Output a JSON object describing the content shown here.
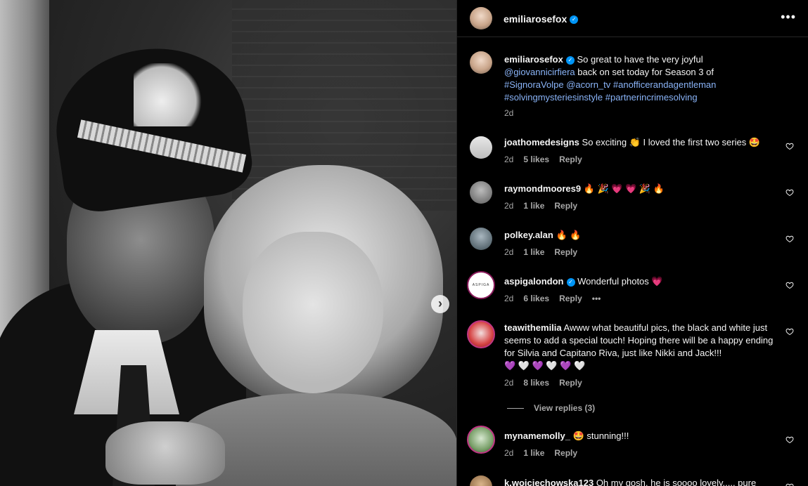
{
  "post": {
    "username": "emiliarosefox",
    "verified": true
  },
  "caption": {
    "username": "emiliarosefox",
    "text_1": "So great to have the very joyful",
    "mention_1": "@giovannicirfiera",
    "text_2": "back on set today for Season 3 of",
    "tag_1": "#SignoraVolpe",
    "mention_2": "@acorn_tv",
    "tag_2": "#anofficerandagentleman",
    "tag_3": "#solvingmysteriesinstyle",
    "tag_4": "#partnerincrimesolving",
    "time": "2d"
  },
  "comments": [
    {
      "username": "joathomedesigns",
      "text": "So exciting 👏 I loved the first two series 🤩",
      "time": "2d",
      "likes": "5 likes",
      "reply": "Reply"
    },
    {
      "username": "raymondmoores9",
      "text": "🔥 🎉 💗 💗 🎉 🔥",
      "time": "2d",
      "likes": "1 like",
      "reply": "Reply"
    },
    {
      "username": "polkey.alan",
      "text": "🔥 🔥",
      "time": "2d",
      "likes": "1 like",
      "reply": "Reply"
    },
    {
      "username": "aspigalondon",
      "text": "Wonderful photos 💗",
      "time": "2d",
      "likes": "6 likes",
      "reply": "Reply",
      "more": "•••"
    },
    {
      "username": "teawithemilia",
      "text": "Awww what beautiful pics, the black and white just seems to add a special touch! Hoping there will be a happy ending for Silvia and Capitano Riva, just like Nikki and Jack!!!",
      "text_2": "💜 🤍 💜 🤍 💜 🤍",
      "time": "2d",
      "likes": "8 likes",
      "reply": "Reply"
    },
    {
      "username": "mynamemolly_",
      "text": "🤩 stunning!!!",
      "time": "2d",
      "likes": "1 like",
      "reply": "Reply"
    },
    {
      "username": "k.wojciechowska123",
      "text": "Oh my gosh, he is soooo lovely..... pure"
    }
  ],
  "view_replies": "View replies (3)",
  "icons": {
    "more": "more-horizontal-icon",
    "heart": "heart-outline-icon",
    "next": "chevron-right-icon",
    "verified": "verified-badge-icon"
  },
  "colors": {
    "background": "#000000",
    "link": "#8ab4f8",
    "secondary_text": "#a8a8a8",
    "verified": "#0095f6"
  }
}
